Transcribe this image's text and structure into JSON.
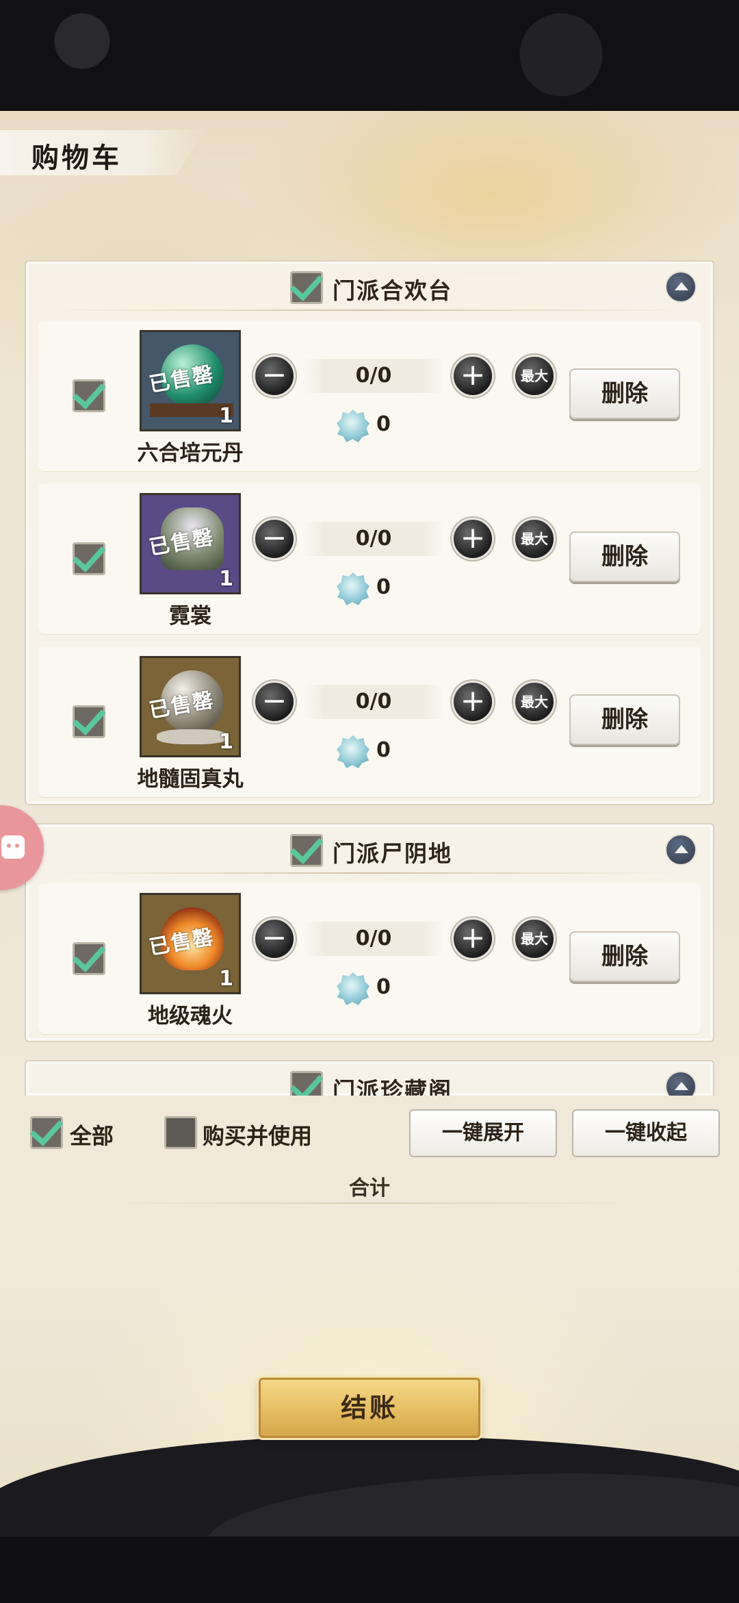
{
  "header": {
    "title": "购物车"
  },
  "groups": [
    {
      "name": "门派合欢台",
      "checked": true,
      "items": [
        {
          "name": "六合培元丹",
          "count": "0/0",
          "price": "0",
          "qty": "1",
          "stamp": "已售罄",
          "checked": true,
          "delete_label": "删除",
          "max_label": "最大"
        },
        {
          "name": "霓裳",
          "count": "0/0",
          "price": "0",
          "qty": "1",
          "stamp": "已售罄",
          "checked": true,
          "delete_label": "删除",
          "max_label": "最大"
        },
        {
          "name": "地髓固真丸",
          "count": "0/0",
          "price": "0",
          "qty": "1",
          "stamp": "已售罄",
          "checked": true,
          "delete_label": "删除",
          "max_label": "最大"
        }
      ]
    },
    {
      "name": "门派尸阴地",
      "checked": true,
      "items": [
        {
          "name": "地级魂火",
          "count": "0/0",
          "price": "0",
          "qty": "1",
          "stamp": "已售罄",
          "checked": true,
          "delete_label": "删除",
          "max_label": "最大"
        }
      ]
    },
    {
      "name": "门派珍藏阁",
      "checked": true,
      "items": []
    }
  ],
  "footer": {
    "select_all_label": "全部",
    "select_all_checked": true,
    "buy_and_use_label": "购买并使用",
    "buy_and_use_checked": false,
    "expand_all_label": "一键展开",
    "collapse_all_label": "一键收起",
    "total_label": "合计",
    "checkout_label": "结账"
  },
  "icons": {
    "collapse": "chevron-up-icon",
    "minus": "minus-icon",
    "plus": "plus-icon",
    "currency": "spirit-stone-icon",
    "float": "game-assistant-icon"
  },
  "colors": {
    "check": "#5ac79a",
    "checkout_gold": "#e6bd62",
    "collapse_blue": "#3f4a61"
  }
}
